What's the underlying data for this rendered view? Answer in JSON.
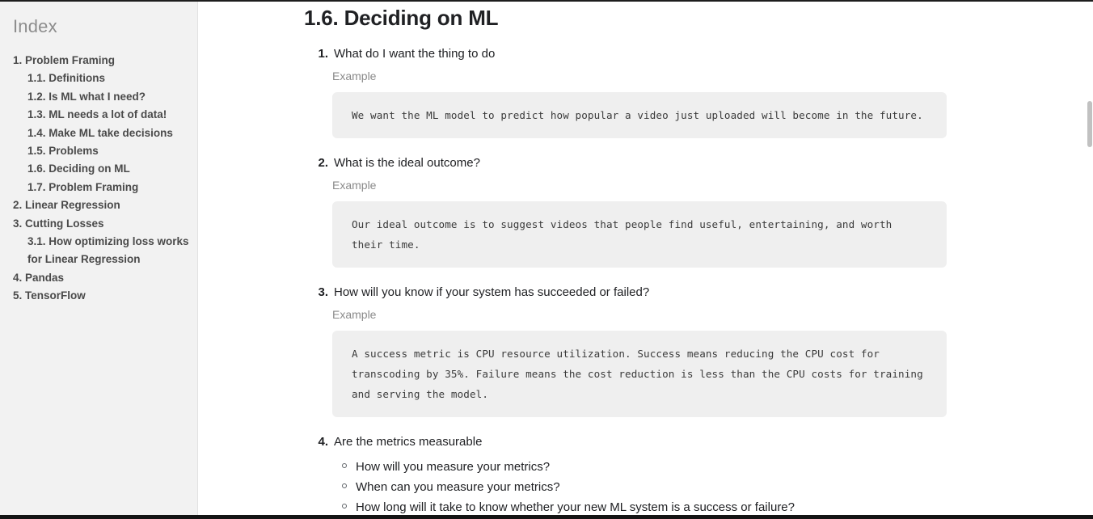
{
  "sidebar": {
    "title": "Index",
    "items": [
      {
        "label": "1. Problem Framing",
        "level": 1
      },
      {
        "label": "1.1. Definitions",
        "level": 2
      },
      {
        "label": "1.2. Is ML what I need?",
        "level": 2
      },
      {
        "label": "1.3. ML needs a lot of data!",
        "level": 2
      },
      {
        "label": "1.4. Make ML take decisions",
        "level": 2
      },
      {
        "label": "1.5. Problems",
        "level": 2
      },
      {
        "label": "1.6. Deciding on ML",
        "level": 2
      },
      {
        "label": "1.7. Problem Framing",
        "level": 2
      },
      {
        "label": "2. Linear Regression",
        "level": 1
      },
      {
        "label": "3. Cutting Losses",
        "level": 1
      },
      {
        "label": "3.1. How optimizing loss works for Linear Regression",
        "level": 2
      },
      {
        "label": "4. Pandas",
        "level": 1
      },
      {
        "label": "5. TensorFlow",
        "level": 1
      }
    ]
  },
  "main": {
    "title": "1.6. Deciding on ML",
    "steps": [
      {
        "num": "1.",
        "text": "What do I want the thing to do",
        "example_label": "Example",
        "code": "We want the ML model to predict how popular a video just uploaded will become in the future."
      },
      {
        "num": "2.",
        "text": "What is the ideal outcome?",
        "example_label": "Example",
        "code": "Our ideal outcome is to suggest videos that people find useful, entertaining, and worth their time."
      },
      {
        "num": "3.",
        "text": "How will you know if your system has succeeded or failed?",
        "example_label": "Example",
        "code": "A success metric is CPU resource utilization. Success means reducing the CPU cost for transcoding by 35%. Failure means the cost reduction is less than the CPU costs for training and serving the model."
      },
      {
        "num": "4.",
        "text": "Are the metrics measurable",
        "subitems": [
          "How will you measure your metrics?",
          "When can you measure your metrics?",
          "How long will it take to know whether your new ML system is a success or failure?"
        ]
      }
    ]
  },
  "colors": {
    "sidebar_bg": "#f2f2f2",
    "sidebar_title": "#8d8d8d",
    "sidebar_item": "#4a4a4a",
    "title": "#202124",
    "code_bg": "#efefef",
    "code_text": "#3b3b3b",
    "example_label": "#8a8a8a",
    "scrollbar_thumb": "#c1c1c1"
  }
}
